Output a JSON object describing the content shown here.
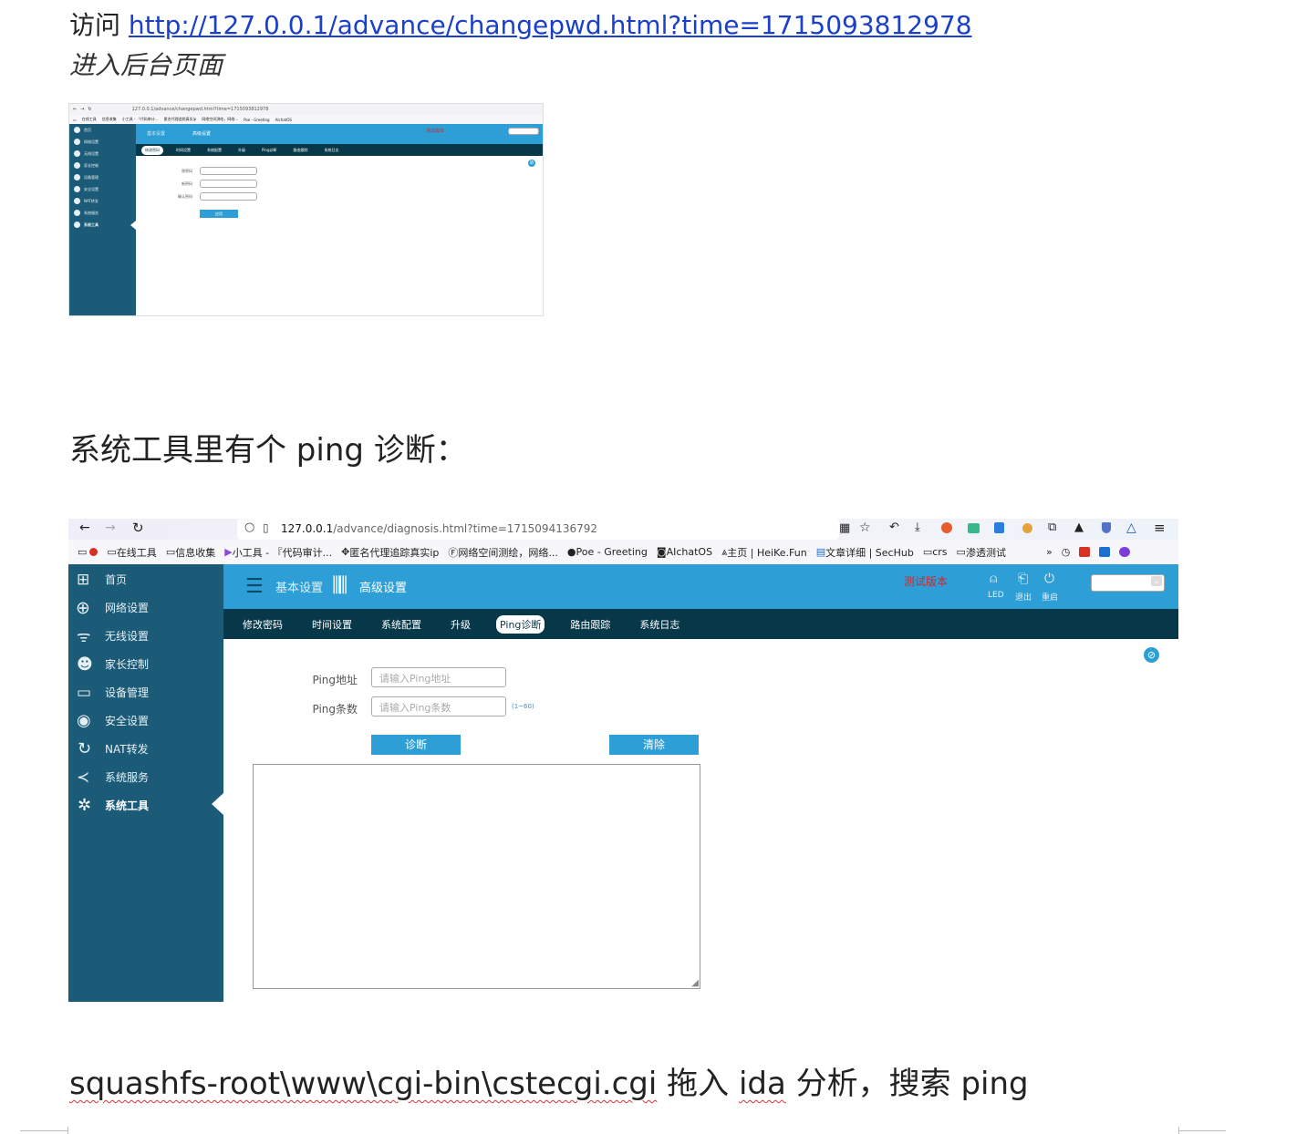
{
  "doc": {
    "line1_prefix": "访问",
    "line1_link": "http://127.0.0.1/advance/changepwd.html?time=1715093812978",
    "line2": "进入后台页面",
    "line3": "系统工具里有个 ping 诊断：",
    "line4_parts": [
      "squashfs-root\\www\\cgi-bin\\cstecgi.cgi",
      " 拖入 ",
      "ida",
      " 分析，搜索 ping"
    ]
  },
  "shot_small": {
    "url": "127.0.0.1/advance/changepwd.html?time=1715093812978",
    "top_tabs": [
      "基本设置",
      "高级设置"
    ],
    "test_label": "测试版本",
    "subnav": [
      "修改密码",
      "时间设置",
      "系统配置",
      "升级",
      "Ping诊断",
      "路由跟踪",
      "系统日志"
    ],
    "active_subnav": "修改密码",
    "sidebar": [
      "首页",
      "网络设置",
      "无线设置",
      "家长控制",
      "设备管理",
      "安全设置",
      "NAT转发",
      "系统服务",
      "系统工具"
    ],
    "form_labels": [
      "原密码",
      "新密码",
      "确认密码"
    ],
    "apply_button": "应用"
  },
  "shot_big": {
    "url_host": "127.0.0.1",
    "url_path": "/advance/diagnosis.html?time=1715094136792",
    "bookmarks": [
      "在线工具",
      "信息收集",
      "小工具 - 『代码审计...",
      "匿名代理追踪真实ip",
      "网络空间测绘，网络...",
      "Poe - Greeting",
      "AIchatOS",
      "主页 | HeiKe.Fun",
      "文章详细 | SecHub",
      "crs",
      "渗透测试"
    ],
    "top_tabs": [
      "基本设置",
      "高级设置"
    ],
    "test_label": "测试版本",
    "top_icons": [
      "LED",
      "退出",
      "重启"
    ],
    "subnav": [
      "修改密码",
      "时间设置",
      "系统配置",
      "升级",
      "Ping诊断",
      "路由跟踪",
      "系统日志"
    ],
    "active_subnav": "Ping诊断",
    "sidebar": [
      "首页",
      "网络设置",
      "无线设置",
      "家长控制",
      "设备管理",
      "安全设置",
      "NAT转发",
      "系统服务",
      "系统工具"
    ],
    "active_sidebar": "系统工具",
    "ping_addr_label": "Ping地址",
    "ping_addr_placeholder": "请输入Ping地址",
    "ping_count_label": "Ping条数",
    "ping_count_placeholder": "请输入Ping条数",
    "ping_count_hint": "(1~60)",
    "diagnose_button": "诊断",
    "clear_button": "清除"
  },
  "colors": {
    "sidebar": "#1b5b78",
    "topbar": "#2e9fd6",
    "subnav": "#06384a",
    "link": "#1a3fc8",
    "test_label": "#d0262a"
  }
}
